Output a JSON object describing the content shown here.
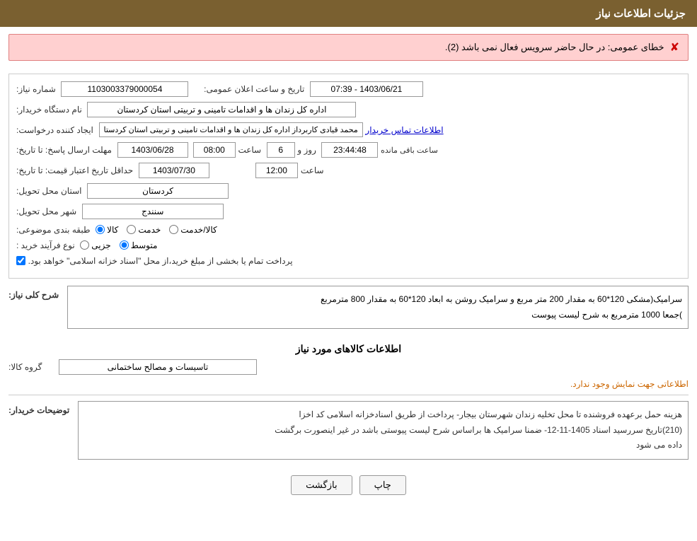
{
  "header": {
    "title": "جزئیات اطلاعات نیاز"
  },
  "error": {
    "message": "خطای عمومی: در حال حاضر سرویس فعال نمی باشد (2)."
  },
  "form": {
    "shomareNiaz_label": "شماره نیاز:",
    "shomareNiaz_value": "1103003379000054",
    "tarikhSaat_label": "تاریخ و ساعت اعلان عمومی:",
    "tarikhSaat_value": "1403/06/21 - 07:39",
    "namDastgah_label": "نام دستگاه خریدار:",
    "namDastgah_value": "اداره کل زندان ها و اقدامات تامینی و تربیتی استان کردستان",
    "ijadKonande_label": "ایجاد کننده درخواست:",
    "ijadKonande_value": "محمد  قیادی کاربرداز اداره کل زندان ها و اقدامات تامینی و تربیتی استان کردستا",
    "ijadKonande_link": "اطلاعات تماس خریدار",
    "mohlatErsalPasokh_label": "مهلت ارسال پاسخ: تا تاریخ:",
    "mohlatErsalPasokh_date": "1403/06/28",
    "mohlatErsalPasokh_time": "08:00",
    "mohlatErsalPasokh_roz": "6",
    "mohlatErsalPasokh_remaining": "23:44:48",
    "remaining_label": "ساعت باقی مانده",
    "roz_label": "روز و",
    "saat_label": "ساعت",
    "hadaqalTarikh_label": "حداقل تاریخ اعتبار قیمت: تا تاریخ:",
    "hadaqalTarikh_date": "1403/07/30",
    "hadaqalTarikh_time": "12:00",
    "ostan_label": "استان محل تحویل:",
    "ostan_value": "کردستان",
    "shahr_label": "شهر محل تحویل:",
    "shahr_value": "سنندج",
    "tabaqe_label": "طبقه بندی موضوعی:",
    "tabaqe_options": [
      {
        "label": "کالا",
        "value": "kala",
        "checked": true
      },
      {
        "label": "خدمت",
        "value": "khadamat",
        "checked": false
      },
      {
        "label": "کالا/خدمت",
        "value": "kala_khadamat",
        "checked": false
      }
    ],
    "noeFarayand_label": "نوع فرآیند خرید :",
    "noeFarayand_options": [
      {
        "label": "جزیی",
        "value": "jozi",
        "checked": false
      },
      {
        "label": "متوسط",
        "value": "motavaset",
        "checked": true
      }
    ],
    "pardakht_checkbox": true,
    "pardakht_label": "پرداخت تمام یا بخشی از مبلغ خرید،از محل \"اسناد خزانه اسلامی\" خواهد بود."
  },
  "sharh": {
    "title": "شرح کلی نیاز:",
    "text1": "سرامیک(مشکی  120*60  به مقدار 200 متر مربع  و  سرامیک روشن به ابعاد 120*60 به مقدار 800 مترمربع",
    "text2": ")جمعا 1000 مترمربع به شرح لیست پیوست"
  },
  "kalaha": {
    "title": "اطلاعات کالاهای مورد نیاز",
    "gorohe_label": "گروه کالا:",
    "gorohe_value": "تاسیسات و مصالح ساختمانی",
    "info_note": "اطلاعاتی جهت نمایش وجود ندارد."
  },
  "buyer_notes": {
    "label": "توضیحات خریدار:",
    "text1": "هزینه حمل برعهده فروشنده  تا محل  تخلیه  زندان  شهرستان بیجار- پرداخت از طریق اسنادخزانه اسلامی کد اخزا",
    "text2": "(210)تاریخ سررسید اسناد 1405-11-12- ضمنا سرامیک ها براساس شرح لیست پیوستی باشد در غیر اینصورت برگشت",
    "text3": "داده می شود"
  },
  "buttons": {
    "print": "چاپ",
    "back": "بازگشت"
  }
}
